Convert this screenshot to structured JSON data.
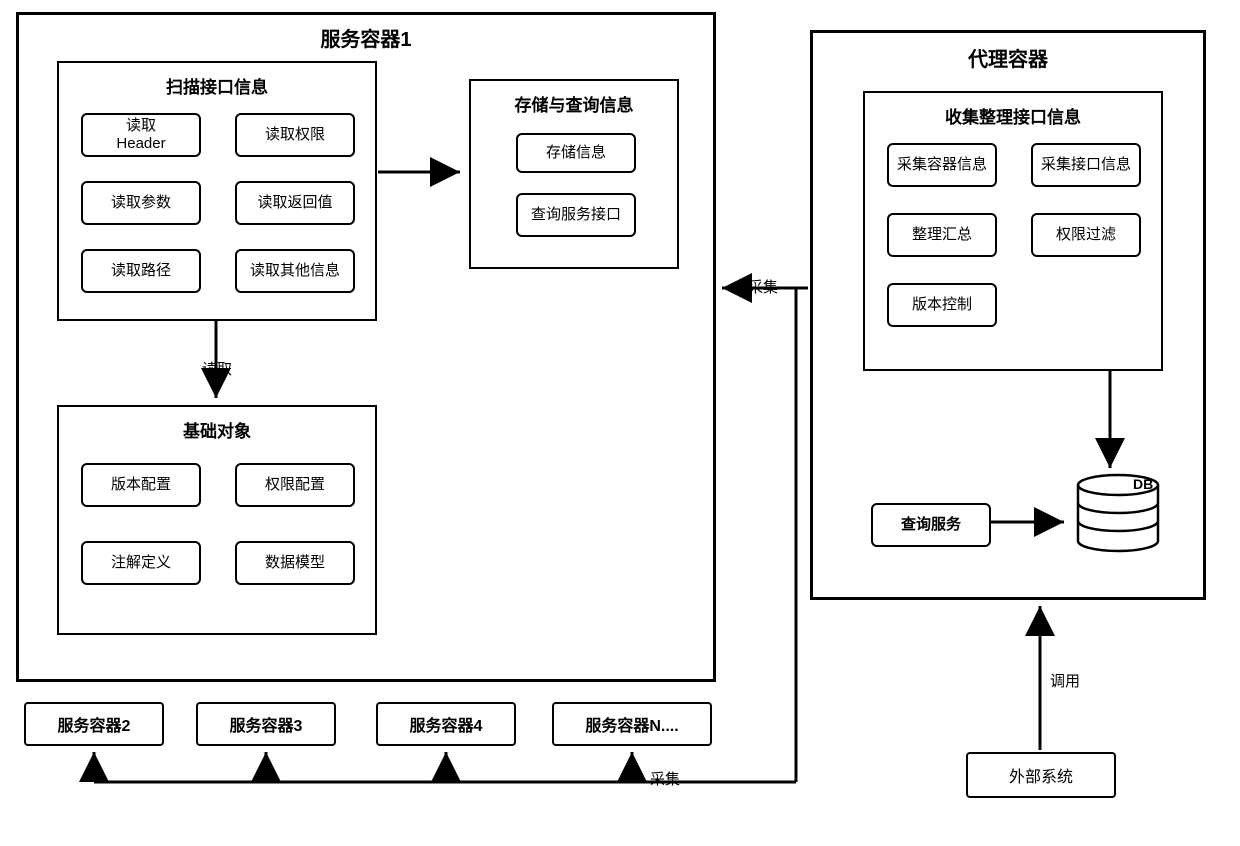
{
  "serviceContainer1": {
    "title": "服务容器1",
    "scanModule": {
      "title": "扫描接口信息",
      "items": [
        "读取\nHeader",
        "读取权限",
        "读取参数",
        "读取返回值",
        "读取路径",
        "读取其他信息"
      ]
    },
    "storageModule": {
      "title": "存储与查询信息",
      "items": [
        "存储信息",
        "查询服务接口"
      ]
    },
    "baseModule": {
      "title": "基础对象",
      "items": [
        "版本配置",
        "权限配置",
        "注解定义",
        "数据模型"
      ]
    }
  },
  "otherContainers": [
    "服务容器2",
    "服务容器3",
    "服务容器4",
    "服务容器N...."
  ],
  "proxyContainer": {
    "title": "代理容器",
    "collectModule": {
      "title": "收集整理接口信息",
      "items": [
        "采集容器信息",
        "采集接口信息",
        "整理汇总",
        "权限过滤",
        "版本控制"
      ]
    },
    "queryService": "查询服务",
    "db": "DB"
  },
  "externalSystem": "外部系统",
  "labels": {
    "read": "读取",
    "collect1": "采集",
    "collect2": "采集",
    "call": "调用"
  }
}
